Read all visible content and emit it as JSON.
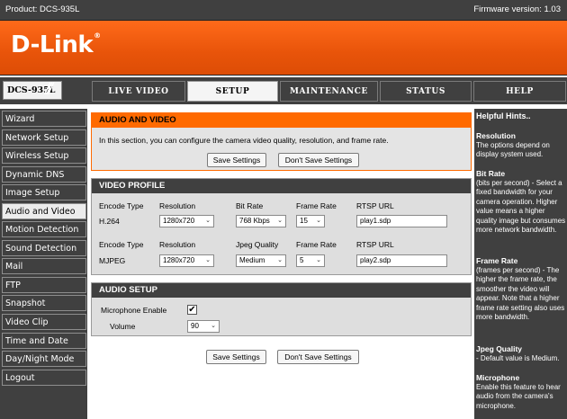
{
  "header": {
    "product": "Product: DCS-935L",
    "firmware": "Firmware version: 1.03",
    "logo": "D-Link",
    "logo_mark": "®",
    "model": "DCS-935L",
    "slashes": "///"
  },
  "nav": {
    "tabs": [
      {
        "label": "LIVE VIDEO"
      },
      {
        "label": "SETUP"
      },
      {
        "label": "MAINTENANCE"
      },
      {
        "label": "STATUS"
      },
      {
        "label": "HELP"
      }
    ]
  },
  "sidebar": {
    "items": [
      {
        "label": "Wizard"
      },
      {
        "label": "Network Setup"
      },
      {
        "label": "Wireless Setup"
      },
      {
        "label": "Dynamic DNS"
      },
      {
        "label": "Image Setup"
      },
      {
        "label": "Audio and Video"
      },
      {
        "label": "Motion Detection"
      },
      {
        "label": "Sound Detection"
      },
      {
        "label": "Mail"
      },
      {
        "label": "FTP"
      },
      {
        "label": "Snapshot"
      },
      {
        "label": "Video Clip"
      },
      {
        "label": "Time and Date"
      },
      {
        "label": "Day/Night Mode"
      },
      {
        "label": "Logout"
      }
    ]
  },
  "audio_video": {
    "title": "AUDIO AND VIDEO",
    "description": "In this section, you can configure the camera video quality, resolution, and frame rate.",
    "save_label": "Save Settings",
    "dont_save_label": "Don't Save Settings"
  },
  "video_profile": {
    "title": "VIDEO PROFILE",
    "profile1": {
      "headers": [
        "Encode Type",
        "Resolution",
        "Bit Rate",
        "Frame Rate",
        "RTSP URL"
      ],
      "encode": "H.264",
      "resolution": "1280x720",
      "bitrate": "768 Kbps",
      "framerate": "15",
      "url": "play1.sdp"
    },
    "profile2": {
      "headers": [
        "Encode Type",
        "Resolution",
        "Jpeg Quality",
        "Frame Rate",
        "RTSP URL"
      ],
      "encode": "MJPEG",
      "resolution": "1280x720",
      "quality": "Medium",
      "framerate": "5",
      "url": "play2.sdp"
    }
  },
  "audio_setup": {
    "title": "AUDIO SETUP",
    "mic_label": "Microphone Enable",
    "mic_checked": "✔",
    "volume_label": "Volume",
    "volume": "90"
  },
  "bottom": {
    "save_label": "Save Settings",
    "dont_save_label": "Don't Save Settings"
  },
  "hints": {
    "title": "Helpful Hints..",
    "items": [
      {
        "title": "Resolution",
        "text": "The options depend on display system used."
      },
      {
        "title": "Bit Rate",
        "text": "(bits per second) - Select a fixed bandwidth for your camera operation. Higher value means a higher quality image but consumes more network bandwidth."
      },
      {
        "title": "Frame Rate",
        "text": "(frames per second) - The higher the frame rate, the smoother the video will appear. Note that a higher frame rate setting also uses more bandwidth."
      },
      {
        "title": "Jpeg Quality",
        "text": "- Default value is Medium."
      },
      {
        "title": "Microphone",
        "text": "Enable this feature to hear audio from the camera's microphone."
      }
    ]
  },
  "colors": {
    "brand_orange": "#ff6a00",
    "dark_gray": "#404040"
  }
}
